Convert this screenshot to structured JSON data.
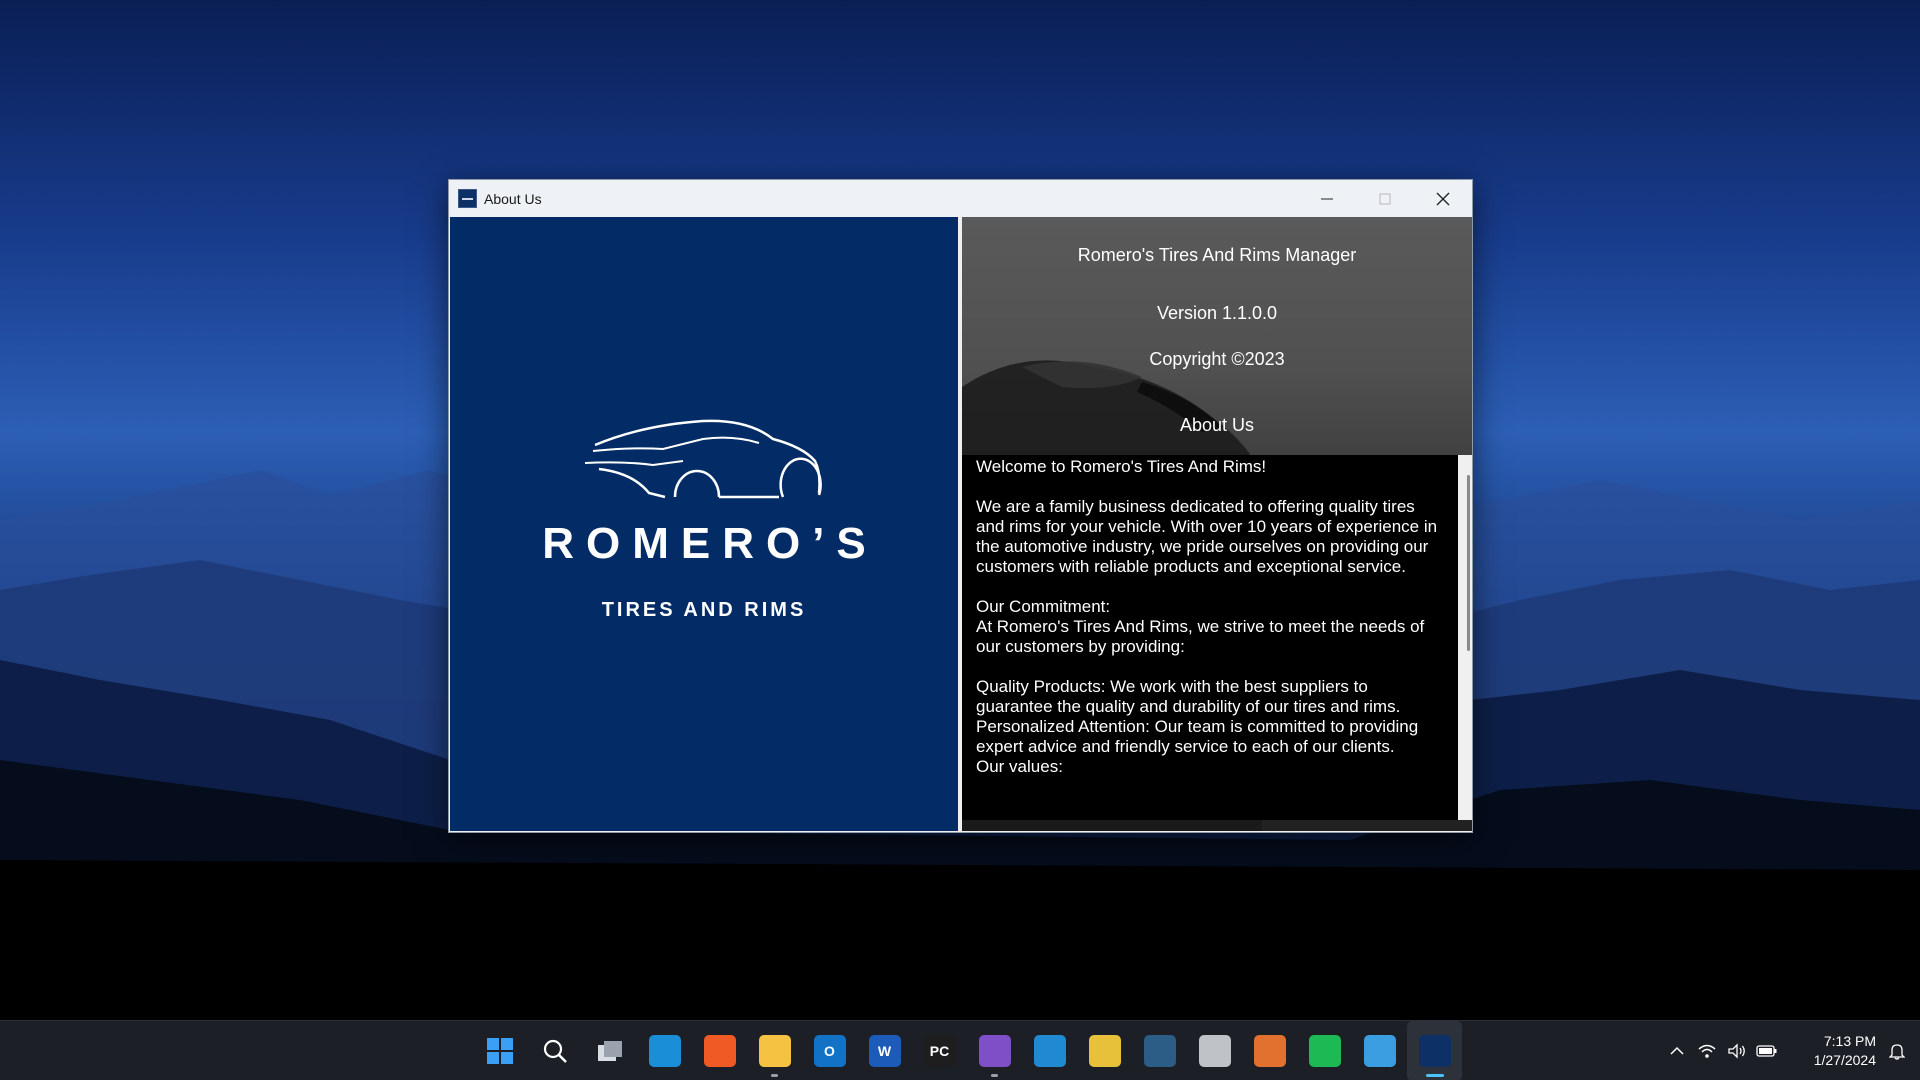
{
  "window": {
    "title": "About Us",
    "buttons": {
      "minimize": "minimize",
      "maximize": "maximize",
      "close": "close"
    }
  },
  "logo": {
    "name": "ROMERO’S",
    "tagline": "TIRES AND RIMS"
  },
  "info": {
    "app_name": "Romero's Tires And Rims Manager",
    "version": "Version 1.1.0.0",
    "copyright": "Copyright ©2023",
    "about_heading": "About Us"
  },
  "about_text": {
    "welcome": "Welcome to Romero's Tires And Rims!",
    "intro": "We are a family business dedicated to offering quality tires and rims for your vehicle. With over 10 years of experience in the automotive industry, we pride ourselves on providing our customers with reliable products and exceptional service.",
    "commitment_heading": "Our Commitment:",
    "commitment_text": "At Romero's Tires And Rims, we strive to meet the needs of our customers by providing:",
    "quality": "Quality Products: We work with the best suppliers to guarantee the quality and durability of our tires and rims.",
    "attention": "Personalized Attention: Our team is committed to providing expert advice and friendly service to each of our clients.",
    "values_heading": "Our values:"
  },
  "taskbar": {
    "apps": [
      {
        "name": "start",
        "label": "",
        "color": "#3aa0f5"
      },
      {
        "name": "search",
        "label": "",
        "color": "transparent"
      },
      {
        "name": "task-view",
        "label": "",
        "color": "transparent"
      },
      {
        "name": "edge",
        "label": "",
        "color": "#1a8fd8"
      },
      {
        "name": "brave",
        "label": "",
        "color": "#f05a24"
      },
      {
        "name": "file-explorer",
        "label": "",
        "color": "#f5c242"
      },
      {
        "name": "outlook",
        "label": "O",
        "color": "#1273c6"
      },
      {
        "name": "word",
        "label": "W",
        "color": "#1d5bb8"
      },
      {
        "name": "pycharm",
        "label": "PC",
        "color": "#1e1e1e"
      },
      {
        "name": "visual-studio",
        "label": "",
        "color": "#7f4fc7"
      },
      {
        "name": "vscode",
        "label": "",
        "color": "#1f8ad2"
      },
      {
        "name": "python-tool",
        "label": "",
        "color": "#e7c13a"
      },
      {
        "name": "mysql-workbench",
        "label": "",
        "color": "#2b5d86"
      },
      {
        "name": "database",
        "label": "",
        "color": "#bfc3c8"
      },
      {
        "name": "git",
        "label": "",
        "color": "#e2702f"
      },
      {
        "name": "spotify",
        "label": "",
        "color": "#1db954"
      },
      {
        "name": "notepad",
        "label": "",
        "color": "#3a9ee0"
      },
      {
        "name": "romeros-app",
        "label": "",
        "color": "#0d3167"
      }
    ],
    "time": "7:13 PM",
    "date": "1/27/2024"
  }
}
